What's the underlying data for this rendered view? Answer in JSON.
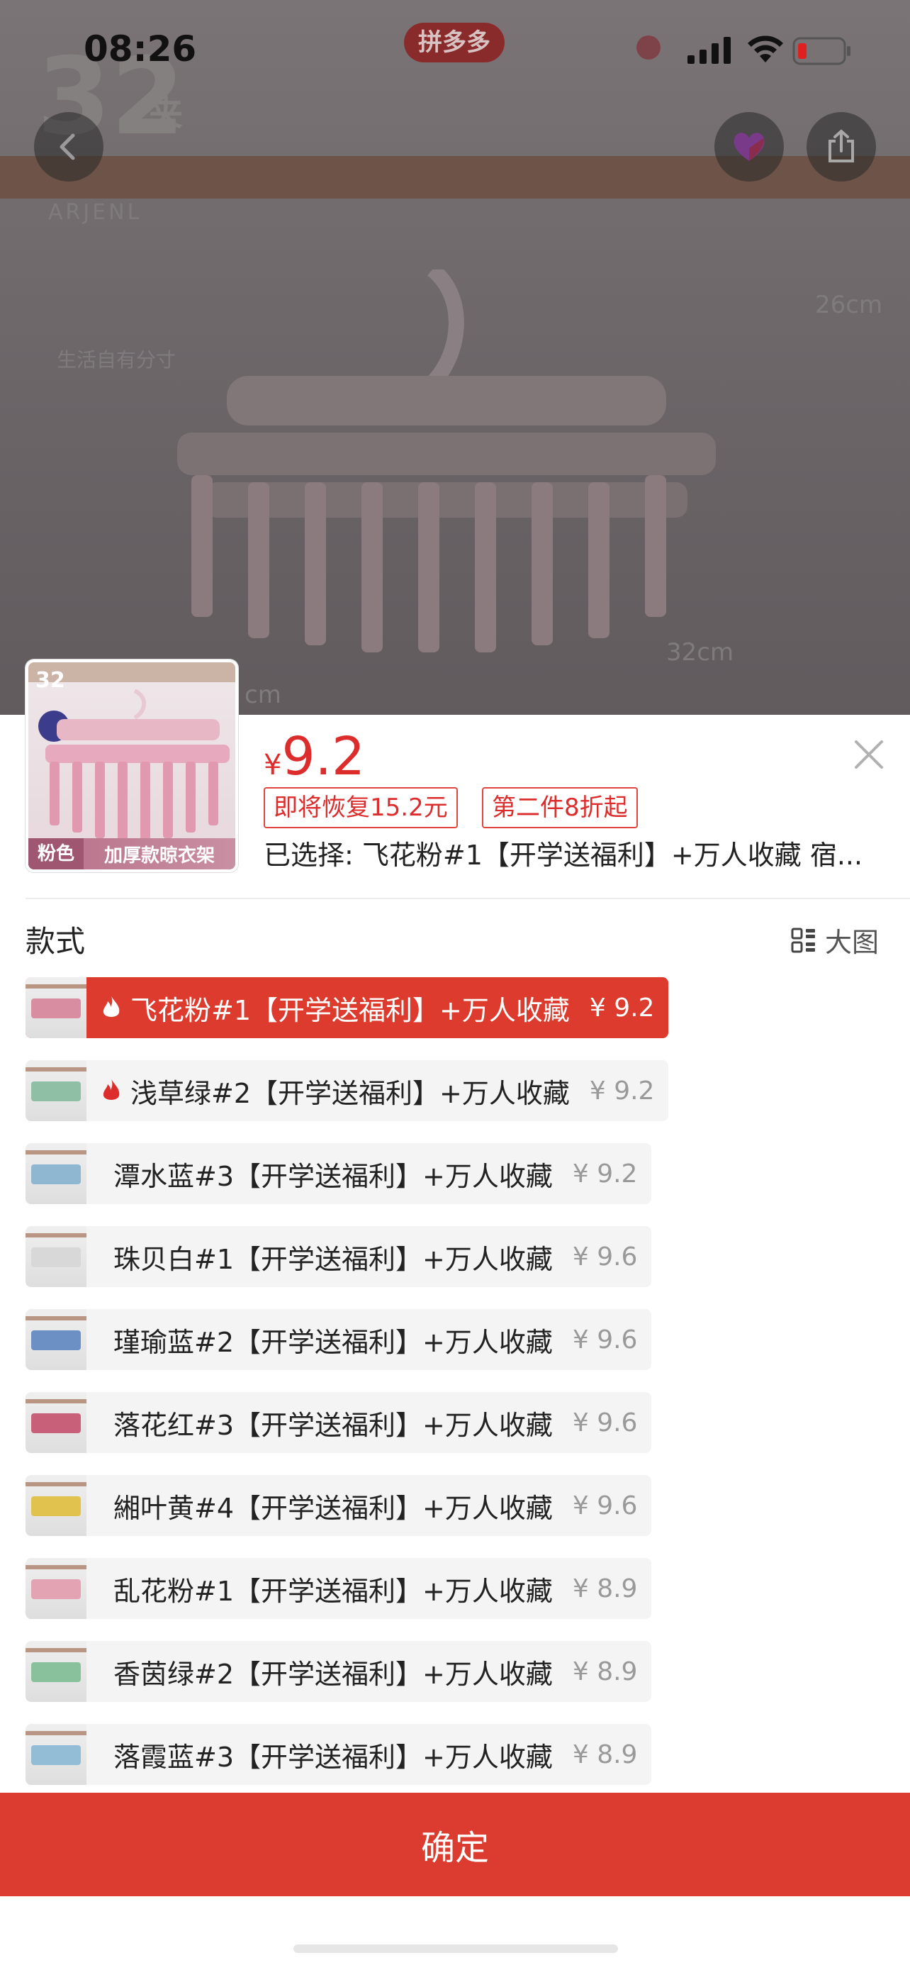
{
  "status_bar": {
    "time": "08:26",
    "app_badge": "拼多多"
  },
  "background_photo": {
    "count_big": "32",
    "count_unit": "夹",
    "brand_mark": "ARJENL",
    "slogan": "生活自有分寸",
    "dim_height": "26cm",
    "dim_width": "32cm",
    "dim_partial": "cm"
  },
  "product": {
    "thumb_count": "32",
    "thumb_caption_left": "粉色",
    "thumb_caption_right": "加厚款晾衣架",
    "currency": "¥",
    "price": "9.2",
    "promo_tags": [
      "即将恢复15.2元",
      "第二件8折起"
    ],
    "selected_text": "已选择: 飞花粉#1【开学送福利】+万人收藏 宿..."
  },
  "options_section": {
    "title": "款式",
    "view_large_label": "大图"
  },
  "options": [
    {
      "name": "飞花粉#1【开学送福利】+万人收藏",
      "price": "¥ 9.2",
      "hot": true,
      "selected": true,
      "color": "#d98da0"
    },
    {
      "name": "浅草绿#2【开学送福利】+万人收藏",
      "price": "¥ 9.2",
      "hot": true,
      "selected": false,
      "color": "#8fbfa5"
    },
    {
      "name": "潭水蓝#3【开学送福利】+万人收藏",
      "price": "¥ 9.2",
      "hot": false,
      "selected": false,
      "color": "#8fb7d2"
    },
    {
      "name": "珠贝白#1【开学送福利】+万人收藏",
      "price": "¥ 9.6",
      "hot": false,
      "selected": false,
      "color": "#d8d8d8"
    },
    {
      "name": "瑾瑜蓝#2【开学送福利】+万人收藏",
      "price": "¥ 9.6",
      "hot": false,
      "selected": false,
      "color": "#6c8fc4"
    },
    {
      "name": "落花红#3【开学送福利】+万人收藏",
      "price": "¥ 9.6",
      "hot": false,
      "selected": false,
      "color": "#c9607a"
    },
    {
      "name": "緗叶黄#4【开学送福利】+万人收藏",
      "price": "¥ 9.6",
      "hot": false,
      "selected": false,
      "color": "#e1c24e"
    },
    {
      "name": "乱花粉#1【开学送福利】+万人收藏",
      "price": "¥ 8.9",
      "hot": false,
      "selected": false,
      "color": "#e3a3b3"
    },
    {
      "name": "香茵绿#2【开学送福利】+万人收藏",
      "price": "¥ 8.9",
      "hot": false,
      "selected": false,
      "color": "#89c19c"
    },
    {
      "name": "落霞蓝#3【开学送福利】+万人收藏",
      "price": "¥ 8.9",
      "hot": false,
      "selected": false,
      "color": "#93bcd6"
    }
  ],
  "confirm_label": "确定",
  "colors": {
    "accent": "#dd2c2c",
    "confirm": "#dc3b2f"
  }
}
